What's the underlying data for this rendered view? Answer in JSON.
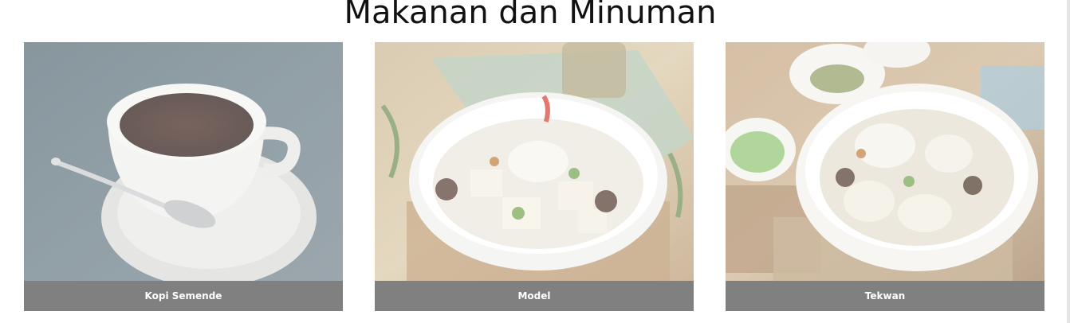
{
  "section": {
    "title": "Makanan dan Minuman"
  },
  "cards": [
    {
      "caption": "Kopi Semende",
      "image": "coffee-cup-photo"
    },
    {
      "caption": "Model",
      "image": "model-soup-bowl-photo"
    },
    {
      "caption": "Tekwan",
      "image": "tekwan-soup-bowl-photo"
    }
  ],
  "colors": {
    "caption_bg": "#808080",
    "caption_text": "#ffffff",
    "title_text": "#111111"
  }
}
